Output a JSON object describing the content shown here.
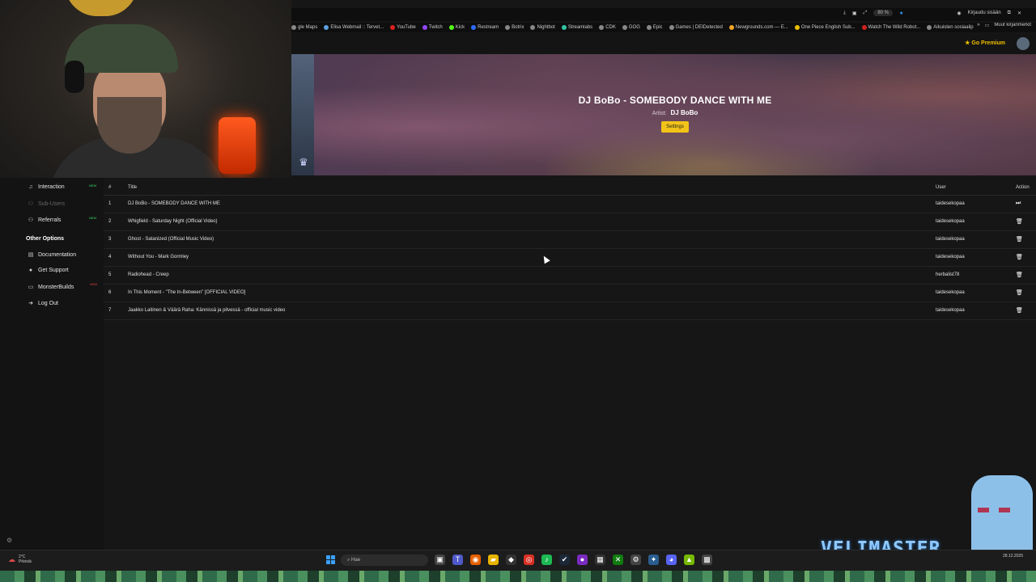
{
  "browser": {
    "bookmarks": [
      "gle Maps",
      "Elisa Webmail :: Tervet...",
      "YouTube",
      "Twitch",
      "Kick",
      "Restream",
      "Botrix",
      "Nightbot",
      "Streamlabs",
      "CDK",
      "GOG",
      "Epic",
      "Games | DEIDetected",
      "Newgrounds.com — E...",
      "One Piece English Sub...",
      "Watch The Wild Robot...",
      "Aikuisten sosiaalipalve..."
    ],
    "bookmark_colors": [
      "#888",
      "#5aa0e0",
      "#e02020",
      "#9146ff",
      "#53fc18",
      "#2b6cff",
      "#888",
      "#888",
      "#31c3a2",
      "#888",
      "#888",
      "#888",
      "#888",
      "#f5a623",
      "#e8c000",
      "#d02020",
      "#888"
    ],
    "other_bookmarks": "Muut kirjanmerkit",
    "zoom": "80 %",
    "signin": "Kirjaudu sisään"
  },
  "topnav": {
    "premium": "Go Premium"
  },
  "hero": {
    "song_title": "DJ BoBo - SOMEBODY DANCE WITH ME",
    "artist_label": "Artist:",
    "artist_name": "DJ BoBo",
    "settings_button": "Settings"
  },
  "sidebar": {
    "items": [
      {
        "label": "Interaction",
        "icon": "music-note-icon",
        "badge": "NEW"
      },
      {
        "label": "Sub-Users",
        "icon": "users-icon"
      },
      {
        "label": "Referrals",
        "icon": "users-icon",
        "badge": "NEW"
      }
    ],
    "section_title": "Other Options",
    "options": [
      {
        "label": "Documentation",
        "icon": "book-icon"
      },
      {
        "label": "Get Support",
        "icon": "help-icon"
      },
      {
        "label": "MonsterBuilds",
        "icon": "monitor-icon",
        "badge": "NEW"
      },
      {
        "label": "Log Out",
        "icon": "logout-icon"
      }
    ]
  },
  "queue": {
    "headers": {
      "num": "#",
      "title": "Title",
      "user": "User",
      "action": "Action"
    },
    "rows": [
      {
        "num": "1",
        "title": "DJ BoBo - SOMEBODY DANCE WITH ME",
        "user": "taidesekopaa",
        "action": "skip-icon"
      },
      {
        "num": "2",
        "title": "Whigfield - Saturday Night (Official Video)",
        "user": "taidesekopaa",
        "action": "trash-icon"
      },
      {
        "num": "3",
        "title": "Ghost - Satanized (Official Music Video)",
        "user": "taidesekopaa",
        "action": "trash-icon"
      },
      {
        "num": "4",
        "title": "Without You - Mark Gormley",
        "user": "taidesekopaa",
        "action": "trash-icon"
      },
      {
        "num": "5",
        "title": "Radiohead - Creep",
        "user": "herbalist78",
        "action": "trash-icon"
      },
      {
        "num": "6",
        "title": "In This Moment - \"The In-Between\" [OFFICIAL VIDEO]",
        "user": "taidesekopaa",
        "action": "trash-icon"
      },
      {
        "num": "7",
        "title": "Jaakko Laitinen & Väärä Raha: Kännissä ja pilvessä - official music video",
        "user": "taidesekopaa",
        "action": "trash-icon"
      }
    ]
  },
  "overlay": {
    "brand": "VELIMASTER"
  },
  "taskbar": {
    "temperature": "2°C",
    "weather_text": "Pilvistä",
    "search_placeholder": "Hae",
    "date": "28.12.2025"
  }
}
